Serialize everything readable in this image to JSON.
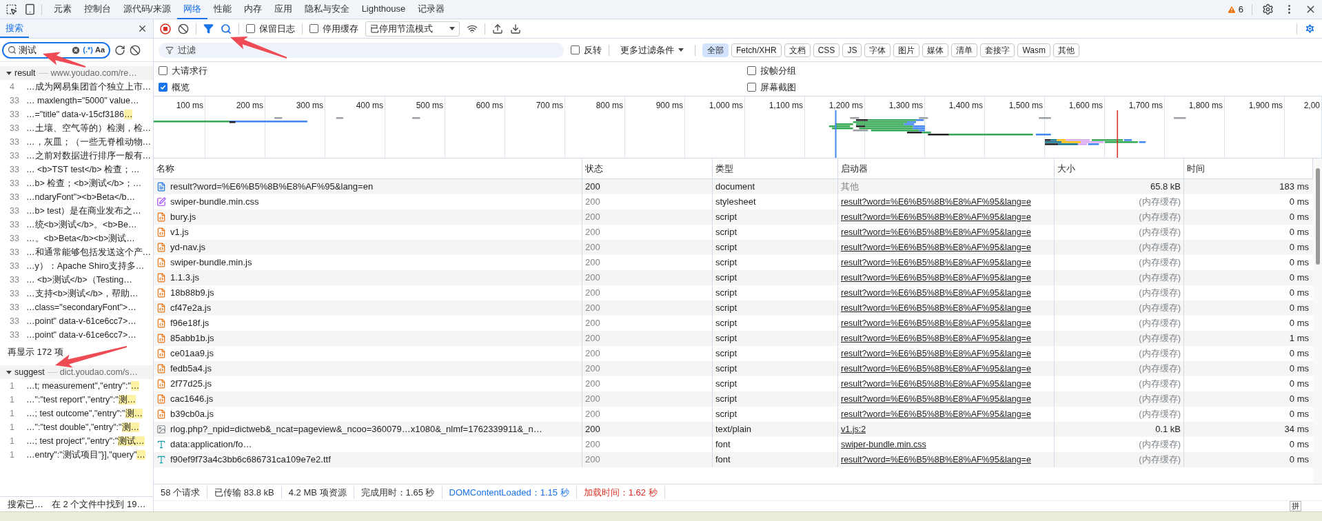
{
  "top_tabs": [
    {
      "label": "元素",
      "selected": false
    },
    {
      "label": "控制台",
      "selected": false
    },
    {
      "label": "源代码/来源",
      "selected": false
    },
    {
      "label": "网络",
      "selected": true
    },
    {
      "label": "性能",
      "selected": false
    },
    {
      "label": "内存",
      "selected": false
    },
    {
      "label": "应用",
      "selected": false
    },
    {
      "label": "隐私与安全",
      "selected": false
    },
    {
      "label": "Lighthouse",
      "selected": false
    },
    {
      "label": "记录器",
      "selected": false
    }
  ],
  "issues_count": "6",
  "search_panel": {
    "tab": "搜索",
    "query": "测试",
    "regex_label": "(.*)",
    "case_label": "Aa",
    "groups": [
      {
        "name": "result",
        "url": "www.youdao.com/re…",
        "expanded": true,
        "more": "再显示 172 项",
        "matches": [
          {
            "line": "4",
            "text": "…成为网易集团首个独立上市…"
          },
          {
            "line": "33",
            "text": "… maxlength=\"5000\" value…"
          },
          {
            "line": "33",
            "text": "…=\"title\" data-v-15cf3186",
            "match": "…"
          },
          {
            "line": "33",
            "text": "…土壤、空气等的）检测，检…"
          },
          {
            "line": "33",
            "text": "…，灰皿；（一些无脊椎动物…"
          },
          {
            "line": "33",
            "text": "…之前对数据进行排序一般有…"
          },
          {
            "line": "33",
            "text": "… <b>TST test</b> 检查；…"
          },
          {
            "line": "33",
            "text": "…b> 检查；<b>测试</b>；…"
          },
          {
            "line": "33",
            "text": "…ndaryFont\"><b>Beta</b…"
          },
          {
            "line": "33",
            "text": "…b> test）是在商业发布之…"
          },
          {
            "line": "33",
            "text": "…统<b>测试</b>。<b>Be…"
          },
          {
            "line": "33",
            "text": "…。<b>Beta</b><b>测试…"
          },
          {
            "line": "33",
            "text": "…和通常能够包括发送这个产…"
          },
          {
            "line": "33",
            "text": "…y）：Apache Shiro支持多…"
          },
          {
            "line": "33",
            "text": "… <b>测试</b>（Testing…"
          },
          {
            "line": "33",
            "text": "…支持<b>测试</b>，帮助…"
          },
          {
            "line": "33",
            "text": "…class=\"secondaryFont\">…"
          },
          {
            "line": "33",
            "text": "…point\" data-v-61ce6cc7>…"
          },
          {
            "line": "33",
            "text": "…point\" data-v-61ce6cc7>…"
          }
        ]
      },
      {
        "name": "suggest",
        "url": "dict.youdao.com/s…",
        "expanded": true,
        "matches": [
          {
            "line": "1",
            "text": "…t; measurement\",\"entry\":\"",
            "match": "…"
          },
          {
            "line": "1",
            "text": "…\":\"test report\",\"entry\":\"",
            "match": "测…"
          },
          {
            "line": "1",
            "text": "…; test outcome\",\"entry\":\"",
            "match": "测…"
          },
          {
            "line": "1",
            "text": "…\":\"test double\",\"entry\":\"",
            "match": "测…"
          },
          {
            "line": "1",
            "text": "…; test project\",\"entry\":\"",
            "match": "测试…"
          },
          {
            "line": "1",
            "text": "…entry\":\"测试项目\"}],\"query\"",
            "match": "…"
          }
        ]
      }
    ],
    "status": [
      "搜索已…",
      "在 2 个文件中找到 19…"
    ]
  },
  "toolbar": {
    "recording": true,
    "filter_active": true,
    "search_active": true,
    "preserve_log": {
      "label": "保留日志",
      "checked": false
    },
    "disable_cache": {
      "label": "停用缓存",
      "checked": false
    },
    "throttling": "已停用节流模式"
  },
  "filter": {
    "placeholder": "过滤",
    "invert": {
      "label": "反转",
      "checked": false
    },
    "more": "更多过滤条件",
    "chips": [
      {
        "label": "全部",
        "selected": true
      },
      {
        "label": "Fetch/XHR",
        "selected": false
      },
      {
        "label": "文档",
        "selected": false
      },
      {
        "label": "CSS",
        "selected": false
      },
      {
        "label": "JS",
        "selected": false
      },
      {
        "label": "字体",
        "selected": false
      },
      {
        "label": "图片",
        "selected": false
      },
      {
        "label": "媒体",
        "selected": false
      },
      {
        "label": "清单",
        "selected": false
      },
      {
        "label": "套接字",
        "selected": false
      },
      {
        "label": "Wasm",
        "selected": false
      },
      {
        "label": "其他",
        "selected": false
      }
    ]
  },
  "options": [
    {
      "label": "大请求行",
      "checked": false
    },
    {
      "label": "按帧分组",
      "checked": false
    },
    {
      "label": "概览",
      "checked": true
    },
    {
      "label": "屏幕截图",
      "checked": false
    }
  ],
  "timeline": {
    "ticks": [
      "100 ms",
      "200 ms",
      "300 ms",
      "400 ms",
      "500 ms",
      "600 ms",
      "700 ms",
      "800 ms",
      "900 ms",
      "1,000 ms",
      "1,100 ms",
      "1,200 ms",
      "1,300 ms",
      "1,400 ms",
      "1,500 ms",
      "1,600 ms",
      "1,700 ms",
      "1,800 ms",
      "1,900 ms",
      "2,00"
    ]
  },
  "table": {
    "columns": [
      "名称",
      "状态",
      "类型",
      "启动器",
      "大小",
      "时间"
    ],
    "rows": [
      {
        "kind": "document",
        "name": "result?word=%E6%B5%8B%E8%AF%95&lang=en",
        "status": "200",
        "type": "document",
        "initiator": "其他",
        "initiator_link": false,
        "size": "65.8 kB",
        "time": "183 ms",
        "cached": false
      },
      {
        "kind": "stylesheet",
        "name": "swiper-bundle.min.css",
        "status": "200",
        "type": "stylesheet",
        "initiator": "result?word=%E6%B5%8B%E8%AF%95&lang=e",
        "initiator_link": true,
        "size": "(内存缓存)",
        "time": "0 ms",
        "cached": true
      },
      {
        "kind": "script",
        "name": "bury.js",
        "status": "200",
        "type": "script",
        "initiator": "result?word=%E6%B5%8B%E8%AF%95&lang=e",
        "initiator_link": true,
        "size": "(内存缓存)",
        "time": "0 ms",
        "cached": true
      },
      {
        "kind": "script",
        "name": "v1.js",
        "status": "200",
        "type": "script",
        "initiator": "result?word=%E6%B5%8B%E8%AF%95&lang=e",
        "initiator_link": true,
        "size": "(内存缓存)",
        "time": "0 ms",
        "cached": true
      },
      {
        "kind": "script",
        "name": "yd-nav.js",
        "status": "200",
        "type": "script",
        "initiator": "result?word=%E6%B5%8B%E8%AF%95&lang=e",
        "initiator_link": true,
        "size": "(内存缓存)",
        "time": "0 ms",
        "cached": true
      },
      {
        "kind": "script",
        "name": "swiper-bundle.min.js",
        "status": "200",
        "type": "script",
        "initiator": "result?word=%E6%B5%8B%E8%AF%95&lang=e",
        "initiator_link": true,
        "size": "(内存缓存)",
        "time": "0 ms",
        "cached": true
      },
      {
        "kind": "script",
        "name": "1.1.3.js",
        "status": "200",
        "type": "script",
        "initiator": "result?word=%E6%B5%8B%E8%AF%95&lang=e",
        "initiator_link": true,
        "size": "(内存缓存)",
        "time": "0 ms",
        "cached": true
      },
      {
        "kind": "script",
        "name": "18b88b9.js",
        "status": "200",
        "type": "script",
        "initiator": "result?word=%E6%B5%8B%E8%AF%95&lang=e",
        "initiator_link": true,
        "size": "(内存缓存)",
        "time": "0 ms",
        "cached": true
      },
      {
        "kind": "script",
        "name": "cf47e2a.js",
        "status": "200",
        "type": "script",
        "initiator": "result?word=%E6%B5%8B%E8%AF%95&lang=e",
        "initiator_link": true,
        "size": "(内存缓存)",
        "time": "0 ms",
        "cached": true
      },
      {
        "kind": "script",
        "name": "f96e18f.js",
        "status": "200",
        "type": "script",
        "initiator": "result?word=%E6%B5%8B%E8%AF%95&lang=e",
        "initiator_link": true,
        "size": "(内存缓存)",
        "time": "0 ms",
        "cached": true
      },
      {
        "kind": "script",
        "name": "85abb1b.js",
        "status": "200",
        "type": "script",
        "initiator": "result?word=%E6%B5%8B%E8%AF%95&lang=e",
        "initiator_link": true,
        "size": "(内存缓存)",
        "time": "1 ms",
        "cached": true
      },
      {
        "kind": "script",
        "name": "ce01aa9.js",
        "status": "200",
        "type": "script",
        "initiator": "result?word=%E6%B5%8B%E8%AF%95&lang=e",
        "initiator_link": true,
        "size": "(内存缓存)",
        "time": "0 ms",
        "cached": true
      },
      {
        "kind": "script",
        "name": "fedb5a4.js",
        "status": "200",
        "type": "script",
        "initiator": "result?word=%E6%B5%8B%E8%AF%95&lang=e",
        "initiator_link": true,
        "size": "(内存缓存)",
        "time": "0 ms",
        "cached": true
      },
      {
        "kind": "script",
        "name": "2f77d25.js",
        "status": "200",
        "type": "script",
        "initiator": "result?word=%E6%B5%8B%E8%AF%95&lang=e",
        "initiator_link": true,
        "size": "(内存缓存)",
        "time": "0 ms",
        "cached": true
      },
      {
        "kind": "script",
        "name": "cac1646.js",
        "status": "200",
        "type": "script",
        "initiator": "result?word=%E6%B5%8B%E8%AF%95&lang=e",
        "initiator_link": true,
        "size": "(内存缓存)",
        "time": "0 ms",
        "cached": true
      },
      {
        "kind": "script",
        "name": "b39cb0a.js",
        "status": "200",
        "type": "script",
        "initiator": "result?word=%E6%B5%8B%E8%AF%95&lang=e",
        "initiator_link": true,
        "size": "(内存缓存)",
        "time": "0 ms",
        "cached": true
      },
      {
        "kind": "image",
        "name": "rlog.php?_npid=dictweb&_ncat=pageview&_ncoo=360079…x1080&_nlmf=1762339911&_n…",
        "status": "200",
        "type": "text/plain",
        "initiator": "v1.js:2",
        "initiator_link": true,
        "size": "0.1 kB",
        "time": "34 ms",
        "cached": false
      },
      {
        "kind": "font",
        "name": "data:application/fo…",
        "status": "200",
        "type": "font",
        "initiator": "swiper-bundle.min.css",
        "initiator_link": true,
        "size": "(内存缓存)",
        "time": "0 ms",
        "cached": true
      },
      {
        "kind": "font",
        "name": "f90ef9f73a4c3bb6c686731ca109e7e2.ttf",
        "status": "200",
        "type": "font",
        "initiator": "result?word=%E6%B5%8B%E8%AF%95&lang=e",
        "initiator_link": true,
        "size": "(内存缓存)",
        "time": "0 ms",
        "cached": true
      }
    ]
  },
  "status_bar": [
    {
      "text": "58 个请求",
      "color": "#333333"
    },
    {
      "text": "已传输 83.8 kB",
      "color": "#333333"
    },
    {
      "text": "4.2 MB 项资源",
      "color": "#333333"
    },
    {
      "text": "完成用时：1.65 秒",
      "color": "#333333"
    },
    {
      "text": "DOMContentLoaded：1.15 秒",
      "color": "#1a73e8"
    },
    {
      "text": "加载时间：1.62 秒",
      "color": "#d93025"
    }
  ],
  "ime_indicator": "拼"
}
